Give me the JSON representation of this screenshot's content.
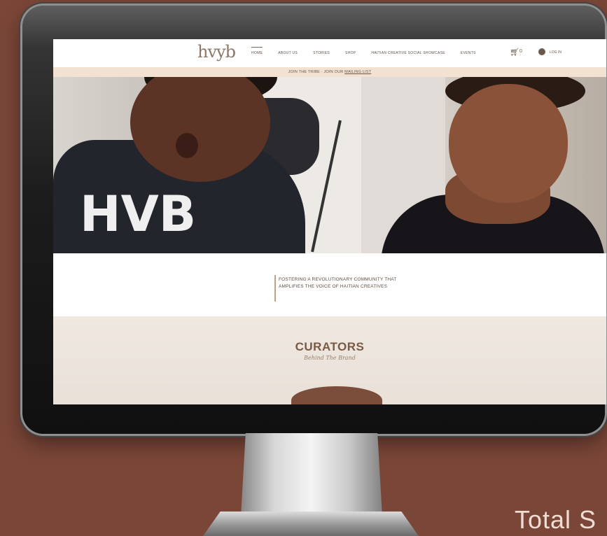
{
  "site": {
    "logo": "hvyb",
    "nav": [
      "HOME",
      "ABOUT US",
      "STORIES",
      "SHOP",
      "HAITIAN CREATIVE SOCIAL SHOWCASE",
      "EVENTS"
    ],
    "cart_count": "0",
    "login_label": "LOG IN",
    "banner_prefix": "JOIN THE TRIBE · JOIN OUR ",
    "banner_link": "MAILING LIST",
    "mission_line1": "FOSTERING A REVOLUTIONARY COMMUNITY THAT",
    "mission_line2": "AMPLIFIES THE VOICE OF HAITIAN CREATIVES",
    "curators_title": "CURATORS",
    "curators_subtitle": "Behind The Brand",
    "hero_shirt_text": "HVB"
  },
  "caption": "Total S",
  "colors": {
    "background": "#7a4638",
    "accent": "#7b5843",
    "banner": "#f3e2d2"
  }
}
